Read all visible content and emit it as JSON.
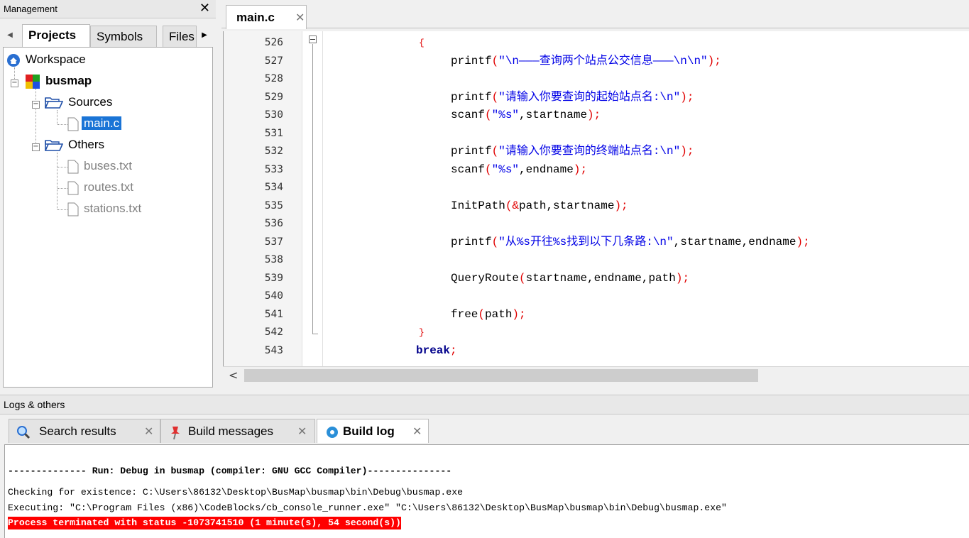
{
  "management": {
    "title": "Management",
    "close": "✕",
    "tabs": [
      "Projects",
      "Symbols",
      "Files"
    ],
    "tree": {
      "workspace": "Workspace",
      "project": "busmap",
      "sources": "Sources",
      "main_file": "main.c",
      "others": "Others",
      "files": [
        "buses.txt",
        "routes.txt",
        "stations.txt"
      ]
    }
  },
  "editor": {
    "tab": {
      "name": "main.c",
      "close": "✕"
    },
    "line_numbers": [
      "526",
      "527",
      "528",
      "529",
      "530",
      "531",
      "532",
      "533",
      "534",
      "535",
      "536",
      "537",
      "538",
      "539",
      "540",
      "541",
      "542",
      "543"
    ],
    "lines": {
      "l526": "{",
      "l527_fn": "printf",
      "l527_str": "\"\\n———查询两个站点公交信息———\\n\\n\"",
      "l529_fn": "printf",
      "l529_str": "\"请输入你要查询的起始站点名:\\n\"",
      "l530_fn": "scanf",
      "l530_str": "\"%s\"",
      "l530_rest": ",startname",
      "l532_fn": "printf",
      "l532_str": "\"请输入你要查询的终端站点名:\\n\"",
      "l533_fn": "scanf",
      "l533_str": "\"%s\"",
      "l533_rest": ",endname",
      "l535_fn": "InitPath",
      "l535_amp": "&",
      "l535_rest": "path,startname",
      "l537_fn": "printf",
      "l537_str": "\"从%s开往%s找到以下几条路:\\n\"",
      "l537_rest": ",startname,endname",
      "l539_fn": "QueryRoute",
      "l539_rest": "startname,endname,path",
      "l541_fn": "free",
      "l541_rest": "path",
      "l542": "}",
      "l543_kw": "break",
      "l543_semi": ";"
    }
  },
  "logs": {
    "title": "Logs & others",
    "tabs": [
      {
        "label": "Search results",
        "close": "✕"
      },
      {
        "label": "Build messages",
        "close": "✕"
      },
      {
        "label": "Build log",
        "close": "✕"
      }
    ],
    "lines": [
      "-------------- Run: Debug in busmap (compiler: GNU GCC Compiler)---------------",
      "Checking for existence: C:\\Users\\86132\\Desktop\\BusMap\\busmap\\bin\\Debug\\busmap.exe",
      "Executing: \"C:\\Program Files (x86)\\CodeBlocks/cb_console_runner.exe\" \"C:\\Users\\86132\\Desktop\\BusMap\\busmap\\bin\\Debug\\busmap.exe\"",
      "Process terminated with status -1073741510 (1 minute(s), 54 second(s))"
    ]
  },
  "colors": {
    "selection": "#1a74d6",
    "operator": "#e00000",
    "string": "#0000e6",
    "keyword": "#00008b",
    "error_bg": "#ff0000"
  }
}
